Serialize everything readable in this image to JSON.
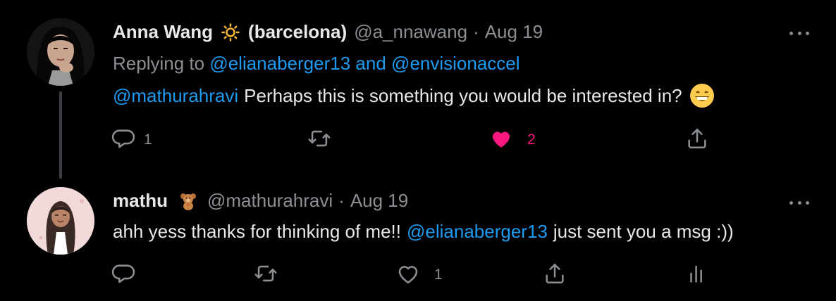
{
  "tweets": [
    {
      "author_name": "Anna Wang",
      "author_tag": "(barcelona)",
      "handle": "@a_nnawang",
      "separator": "·",
      "date": "Aug 19",
      "replying_prefix": "Replying to",
      "replying_mention_1": "@elianaberger13",
      "replying_and": "and",
      "replying_mention_2": "@envisionaccel",
      "mention": "@mathurahravi",
      "text": "Perhaps this is something you would be interested in?",
      "reply_count": "1",
      "like_count": "2",
      "liked": true
    },
    {
      "author_name": "mathu",
      "handle": "@mathurahravi",
      "separator": "·",
      "date": "Aug 19",
      "text_before": "ahh yess thanks for thinking of me!!",
      "mention": "@elianaberger13",
      "text_after": "just sent you a msg :))",
      "like_count": "1",
      "liked": false
    }
  ],
  "icons": [
    "reply-icon",
    "retweet-icon",
    "like-icon",
    "share-icon",
    "analytics-icon",
    "more-icon",
    "sun-emoji",
    "grin-emoji",
    "teddy-bear-emoji"
  ],
  "colors": {
    "link": "#1d9bf0",
    "like": "#f91880",
    "muted": "#8b8f94",
    "background": "#000000"
  }
}
